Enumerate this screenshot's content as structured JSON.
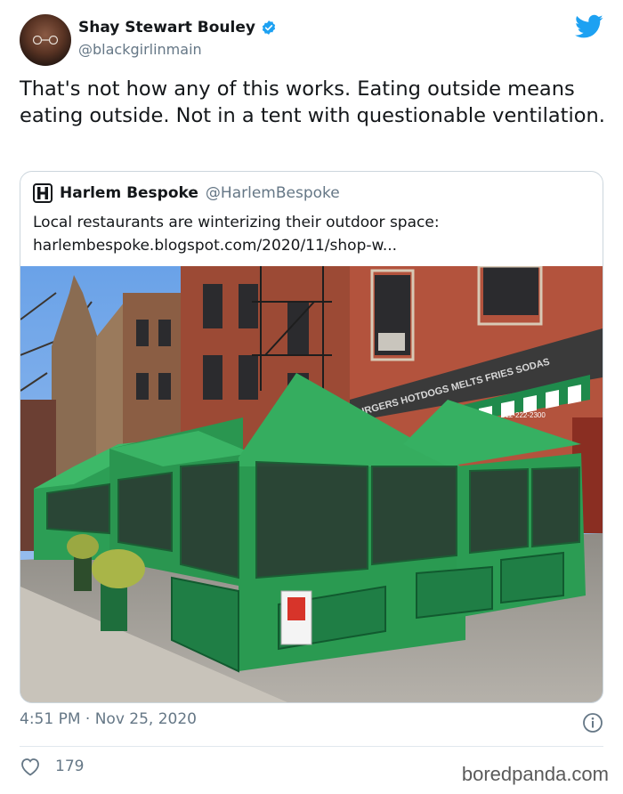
{
  "author": {
    "name": "Shay Stewart Bouley",
    "handle": "@blackgirlinmain",
    "verified": true
  },
  "tweet": {
    "text": "That's not how any of this works. Eating outside means eating outside. Not in a tent with questionable ventilation."
  },
  "quoted": {
    "name": "Harlem Bespoke",
    "handle": "@HarlemBespoke",
    "text_line1": "Local restaurants are winterizing their outdoor space:",
    "text_line2": "harlembespoke.blogspot.com/2020/11/shop-w...",
    "photo": {
      "awning_text": "URGERS HOTDOGS MELTS FRIES SODAS",
      "phone": "212-222-2300"
    }
  },
  "meta": {
    "timestamp": "4:51 PM · Nov 25, 2020",
    "likes": "179"
  },
  "watermark": "boredpanda.com",
  "colors": {
    "twitter_blue": "#1da1f2",
    "tent_green": "#2fa85c",
    "muted": "#657786"
  }
}
